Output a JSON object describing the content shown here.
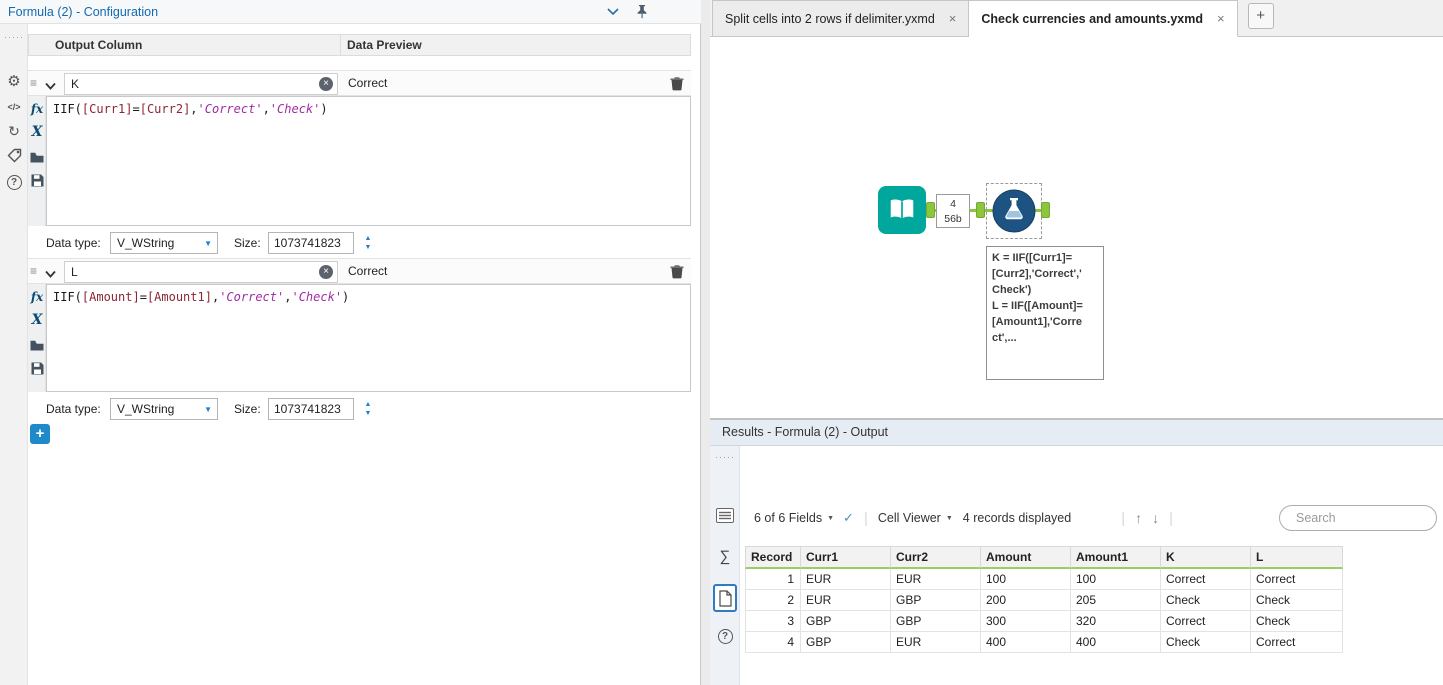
{
  "icons": {
    "dots": "·····",
    "gear": "⚙",
    "code": "</>",
    "refresh": "↻",
    "question": "?",
    "grip": "≡",
    "plus": "+",
    "close": "×",
    "dropdown_arrow": "▼",
    "spin_up": "▲",
    "spin_down": "▼",
    "check": "✓",
    "arrow_up": "↑",
    "arrow_down": "↓",
    "sigma": "∑",
    "fx": "fx",
    "x_var": "X"
  },
  "colors": {
    "accent_blue": "#1569b0",
    "anchor_green": "#8cc63f",
    "tool_teal": "#00a79d",
    "formula_blue": "#1d5382",
    "header_underline_green": "#9ccd62"
  },
  "config": {
    "title": "Formula (2) - Configuration",
    "columns": {
      "output": "Output Column",
      "preview": "Data Preview"
    },
    "data_type_label": "Data type:",
    "size_label": "Size:",
    "expressions": [
      {
        "name": "K",
        "preview": "Correct",
        "data_type": "V_WString",
        "size": "1073741823",
        "expr": {
          "fn": "IIF(",
          "field1": "[Curr1]",
          "op": "=",
          "field2": "[Curr2]",
          "comma1": ",",
          "str1": "'Correct'",
          "comma2": ",",
          "str2": "'Check'",
          "close": ")"
        }
      },
      {
        "name": "L",
        "preview": "Correct",
        "data_type": "V_WString",
        "size": "1073741823",
        "expr": {
          "fn": "IIF(",
          "field1": "[Amount]",
          "op": "=",
          "field2": "[Amount1]",
          "comma1": ",",
          "str1": "'Correct'",
          "comma2": ",",
          "str2": "'Check'",
          "close": ")"
        }
      }
    ]
  },
  "tabs": {
    "tab1": "Split cells into 2 rows if delimiter.yxmd",
    "tab2": "Check currencies and amounts.yxmd"
  },
  "canvas": {
    "connection_count": "4",
    "connection_size": "56b",
    "annotation": {
      "line1": "K = IIF([Curr1]=",
      "line2": "[Curr2],'Correct','",
      "line3": "Check')",
      "line4": "L = IIF([Amount]=",
      "line5": "[Amount1],'Corre",
      "line6": "ct',..."
    }
  },
  "results": {
    "title": "Results - Formula (2) - Output",
    "toolbar": {
      "fields_summary": "6 of 6 Fields",
      "cell_viewer": "Cell Viewer",
      "records_displayed": "4 records displayed",
      "search_placeholder": "Search"
    },
    "table": {
      "headers": [
        "Record",
        "Curr1",
        "Curr2",
        "Amount",
        "Amount1",
        "K",
        "L"
      ],
      "rows": [
        [
          "1",
          "EUR",
          "EUR",
          "100",
          "100",
          "Correct",
          "Correct"
        ],
        [
          "2",
          "EUR",
          "GBP",
          "200",
          "205",
          "Check",
          "Check"
        ],
        [
          "3",
          "GBP",
          "GBP",
          "300",
          "320",
          "Correct",
          "Check"
        ],
        [
          "4",
          "GBP",
          "EUR",
          "400",
          "400",
          "Check",
          "Correct"
        ]
      ]
    }
  }
}
